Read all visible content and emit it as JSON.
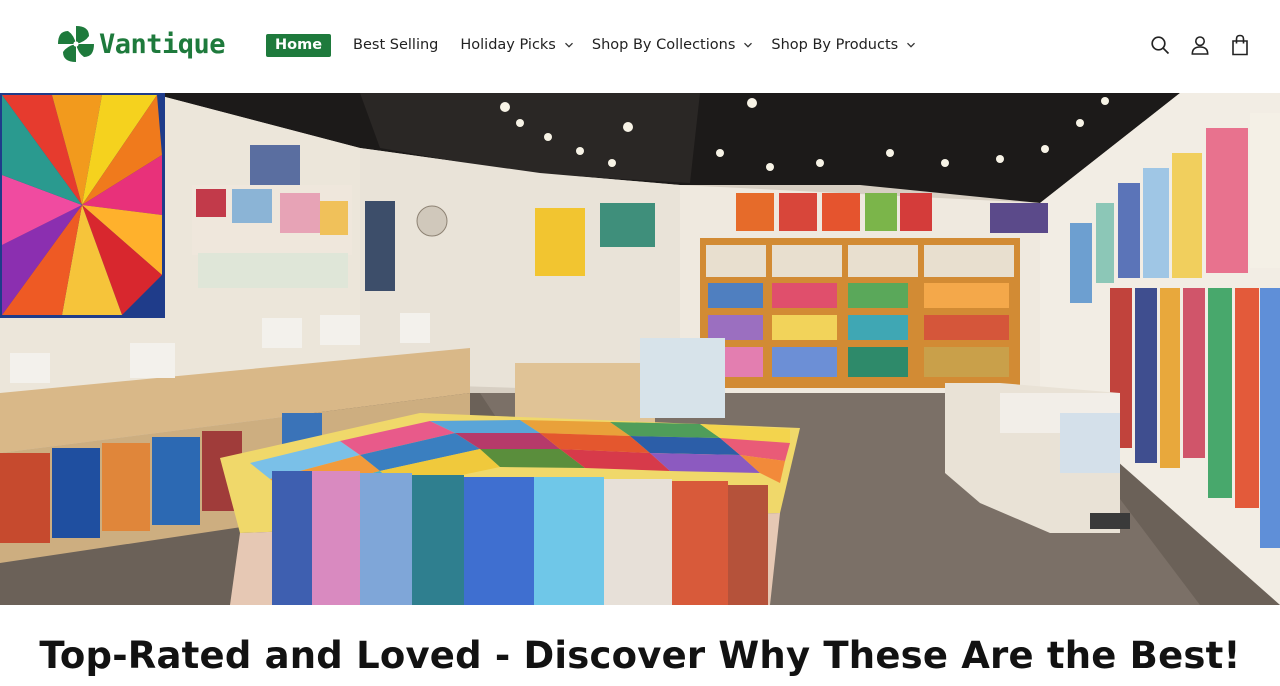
{
  "brand": {
    "name": "Vantique",
    "color": "#1e7a3c"
  },
  "nav": {
    "items": [
      {
        "label": "Home",
        "active": true,
        "dropdown": false
      },
      {
        "label": "Best Selling",
        "active": false,
        "dropdown": false
      },
      {
        "label": "Holiday Picks",
        "active": false,
        "dropdown": true
      },
      {
        "label": "Shop By Collections",
        "active": false,
        "dropdown": true
      },
      {
        "label": "Shop By Products",
        "active": false,
        "dropdown": true
      }
    ]
  },
  "header_icons": [
    "search-icon",
    "account-icon",
    "cart-icon"
  ],
  "hero": {
    "image": "quilt-fabric-store-interior"
  },
  "section": {
    "heading": "Top-Rated and Loved - Discover Why These Are the Best!"
  }
}
